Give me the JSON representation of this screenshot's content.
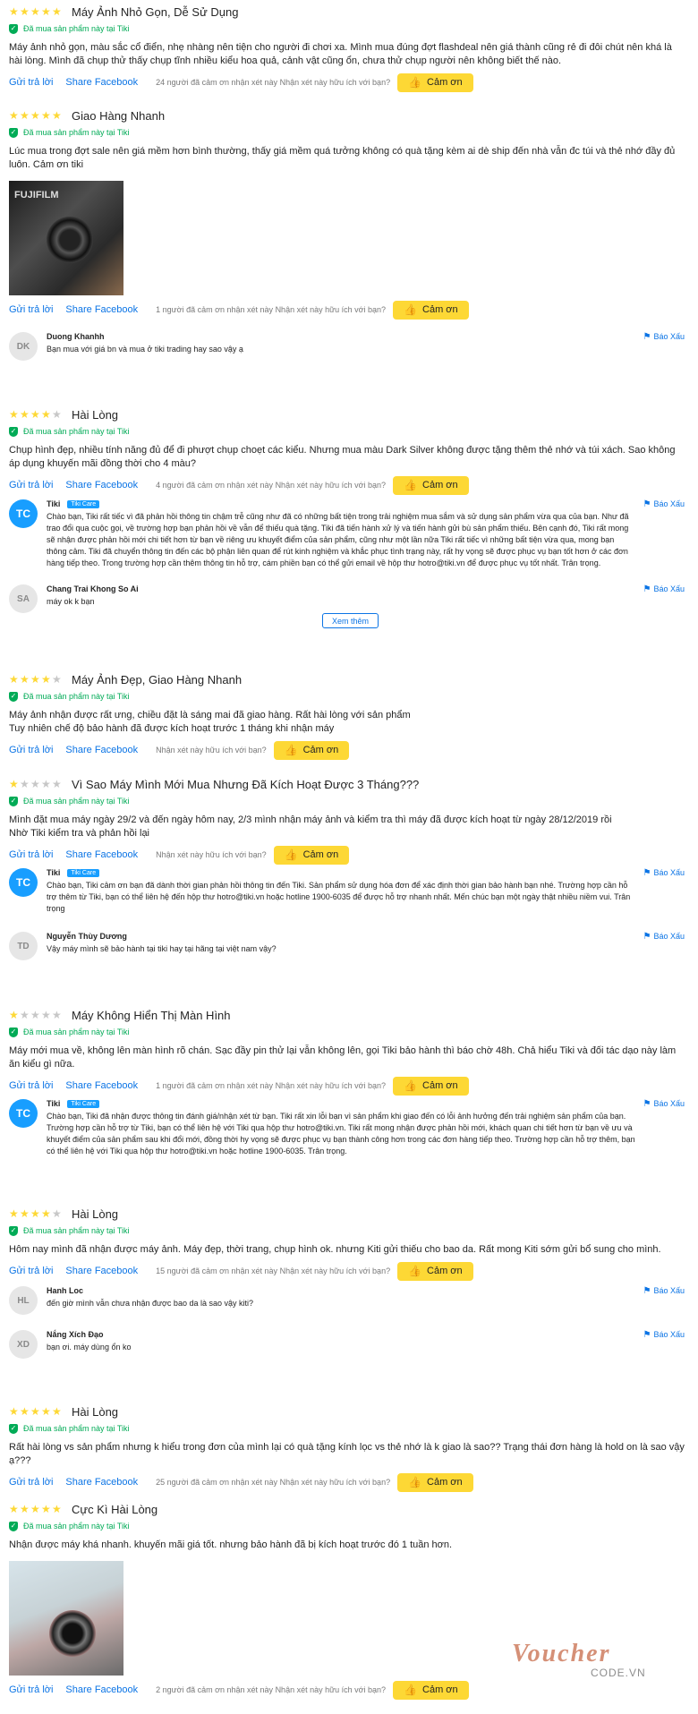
{
  "labels": {
    "verified": "Đã mua sản phẩm này tại Tiki",
    "reply": "Gửi trả lời",
    "share": "Share Facebook",
    "helpful": "Nhận xét này hữu ích với bạn?",
    "thanks": "Cảm ơn",
    "report": "Báo Xấu",
    "tiki_care": "Tiki Care",
    "more": "Xem thêm"
  },
  "reviews": [
    {
      "stars": 5,
      "title": "Máy Ảnh Nhỏ Gọn, Dễ Sử Dụng",
      "body": "Máy ảnh nhỏ gọn, màu sắc cổ điển, nhẹ nhàng nên tiện cho người đi chơi xa. Mình mua đúng đợt flashdeal nên giá thành cũng rẻ đi đôi chút nên khá là hài lòng. Mình đã chụp thử thấy chụp tĩnh nhiều kiểu hoa quả, cảnh vật cũng ổn, chưa thử chụp người nên không biết thế nào.",
      "thank_count": "24 người đã cảm ơn nhận xét này"
    },
    {
      "stars": 5,
      "title": "Giao Hàng Nhanh",
      "body": "Lúc mua trong đợt sale nên giá mềm hơn bình thường, thấy giá mềm quá tưởng không có quà tặng kèm ai dè ship đến nhà vẫn đc túi và thẻ nhớ đầy đủ luôn. Cảm ơn tiki",
      "photo_label": "FUJIFILM",
      "thank_count": "1 người đã cảm ơn nhận xét này"
    },
    {
      "stars": 4,
      "title": "Hài Lòng",
      "body": "Chụp hình đẹp, nhiều tính năng đủ để đi phượt chụp choẹt các kiểu. Nhưng mua màu Dark Silver không được tặng thêm thẻ nhớ và túi xách. Sao không áp dụng khuyến mãi đồng thời cho 4 màu?",
      "thank_count": "4 người đã cảm ơn nhận xét này"
    },
    {
      "stars": 4,
      "title": "Máy Ảnh Đẹp, Giao Hàng Nhanh",
      "body": "Máy ảnh nhận được rất ưng, chiều đặt là sáng mai đã giao hàng. Rất hài lòng với sản phẩm\nTuy nhiên chế độ bảo hành đã được kích hoạt trước 1 tháng khi nhận máy",
      "thank_count": ""
    },
    {
      "stars": 1,
      "title": "Vì Sao Máy Mình Mới Mua Nhưng Đã Kích Hoạt Được 3 Tháng???",
      "body": "Mình đặt mua máy ngày 29/2 và đến ngày hôm nay, 2/3 mình nhận máy ảnh và kiểm tra thì máy đã được kích hoạt từ ngày 28/12/2019 rồi\nNhờ Tiki kiểm tra và phản hồi lại",
      "thank_count": ""
    },
    {
      "stars": 1,
      "title": "Máy Không Hiển Thị Màn Hình",
      "body": "Máy mới mua về, không lên màn hình rõ chán. Sạc đầy pin thử lại vẫn không lên, gọi Tiki bảo hành thì báo chờ 48h. Chả hiểu Tiki và đối tác dạo này làm ăn kiểu gì nữa.",
      "thank_count": "1 người đã cảm ơn nhận xét này"
    },
    {
      "stars": 4,
      "title": "Hài Lòng",
      "body": "Hôm nay mình đã nhận được máy ảnh. Máy đẹp, thời trang, chụp hình ok. nhưng Kiti gửi thiếu cho bao da. Rất mong Kiti sớm gửi bổ sung cho mình.",
      "thank_count": "15 người đã cảm ơn nhận xét này"
    },
    {
      "stars": 5,
      "title": "Hài Lòng",
      "body": "Rất hài lòng vs sản phẩm nhưng k hiểu trong đơn của mình lại có quà tặng kính lọc vs thẻ nhớ là k giao là sao?? Trạng thái đơn hàng là hold on là sao vậy ạ???",
      "thank_count": "25 người đã cảm ơn nhận xét này"
    },
    {
      "stars": 5,
      "title": "Cực Kì Hài Lòng",
      "body": "Nhận được máy khá nhanh. khuyến mãi giá tốt. nhưng bảo hành đã bị kích hoạt trước đó 1 tuần hơn.",
      "thank_count": "2 người đã cảm ơn nhận xét này"
    }
  ],
  "replies": [
    {
      "initials": "DK",
      "name": "Duong Khanhh",
      "text": "Bạn mua với giá bn và mua ở tiki trading hay sao vậy ạ"
    },
    {
      "initials": "TC",
      "name": "Tiki",
      "text": "Chào bạn, Tiki rất tiếc vì đã phản hồi thông tin chậm trễ cũng như đã có những bất tiện trong trải nghiệm mua sắm và sử dụng sản phẩm vừa qua của bạn. Như đã trao đổi qua cuộc gọi, về trường hợp bạn phản hồi về vẫn để thiếu quà tặng. Tiki đã tiến hành xử lý và tiến hành gửi bù sản phẩm thiếu. Bên cạnh đó, Tiki rất mong sẽ nhận được phản hồi mới chi tiết hơn từ bạn về riêng ưu khuyết điểm của sản phẩm, cũng như một lần nữa Tiki rất tiếc vì những bất tiện vừa qua, mong bạn thông cảm. Tiki đã chuyển thông tin đến các bộ phận liên quan để rút kinh nghiệm và khắc phục tình trạng này, rất hy vọng sẽ được phục vụ bạn tốt hơn ở các đơn hàng tiếp theo. Trong trường hợp cần thêm thông tin hỗ trợ, cám phiền bạn có thể gửi email về hộp thư hotro@tiki.vn để được phục vụ tốt nhất. Trân trọng."
    },
    {
      "initials": "SA",
      "name": "Chang Trai Khong So Ai",
      "text": "máy ok k bạn"
    },
    {
      "initials": "TC",
      "name": "Tiki",
      "text": "Chào bạn, Tiki cảm ơn bạn đã dành thời gian phản hồi thông tin đến Tiki. Sản phẩm sử dụng hóa đơn để xác định thời gian bảo hành bạn nhé. Trường hợp cần hỗ trợ thêm từ Tiki, bạn có thể liên hệ đến hộp thư hotro@tiki.vn hoặc hotline 1900-6035 để được hỗ trợ nhanh nhất. Mến chúc bạn một ngày thật nhiều niềm vui. Trân trọng"
    },
    {
      "initials": "TD",
      "name": "Nguyễn Thùy Dương",
      "text": "Vậy máy mình sẽ bảo hành tại tiki hay tại hãng tại việt nam vậy?"
    },
    {
      "initials": "TC",
      "name": "Tiki",
      "text": "Chào bạn, Tiki đã nhận được thông tin đánh giá/nhận xét từ bạn. Tiki rất xin lỗi bạn vì sản phẩm khi giao đến có lỗi ảnh hưởng đến trải nghiệm sản phẩm của bạn. Trường hợp cần hỗ trợ từ Tiki, bạn có thể liên hệ với Tiki qua hộp thư hotro@tiki.vn. Tiki rất mong nhận được phản hồi mới, khách quan chi tiết hơn từ bạn về ưu và khuyết điểm của sản phẩm sau khi đổi mới, đồng thời hy vọng sẽ được phục vụ bạn thành công hơn trong các đơn hàng tiếp theo. Trường hợp cần hỗ trợ thêm, bạn có thể liên hệ với Tiki qua hộp thư hotro@tiki.vn hoặc hotline 1900-6035. Trân trọng."
    },
    {
      "initials": "HL",
      "name": "Hanh Loc",
      "text": "đến giờ mình vẫn chưa nhận được bao da là sao vậy kiti?"
    },
    {
      "initials": "XD",
      "name": "Nắng Xích Đạo",
      "text": "bạn ơi. máy dùng ổn ko"
    }
  ],
  "watermark": {
    "brand": "Voucher",
    "sub": "CODE.VN"
  }
}
